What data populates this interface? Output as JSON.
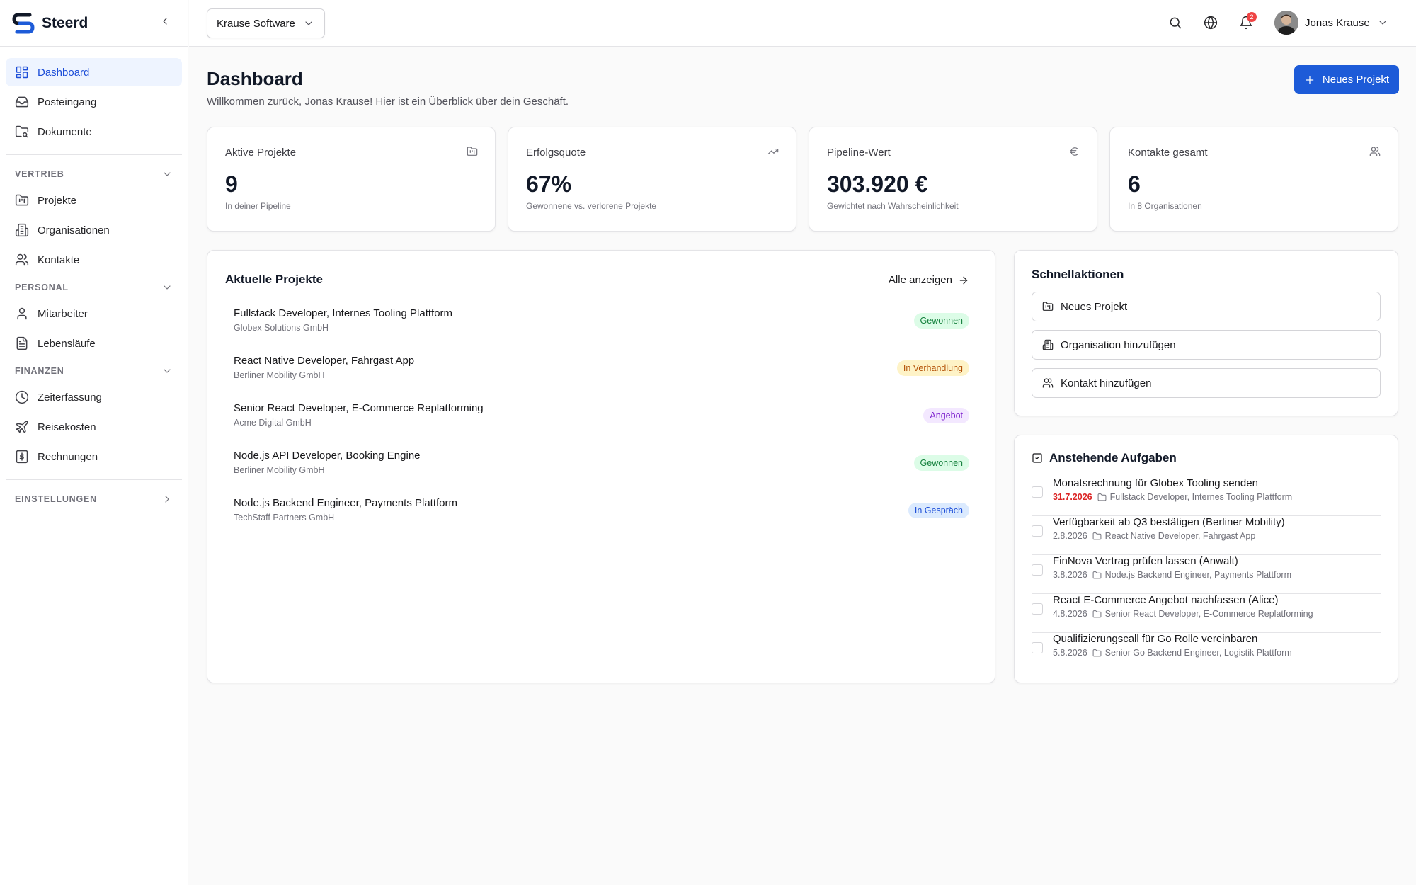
{
  "brand": {
    "name": "Steerd"
  },
  "sidebar": {
    "top_items": [
      {
        "label": "Dashboard",
        "icon": "layout-dashboard-icon",
        "active": true
      },
      {
        "label": "Posteingang",
        "icon": "inbox-icon"
      },
      {
        "label": "Dokumente",
        "icon": "folder-search-icon"
      }
    ],
    "groups": [
      {
        "label": "VERTRIEB",
        "expanded": true,
        "items": [
          {
            "label": "Projekte",
            "icon": "folder-kanban-icon"
          },
          {
            "label": "Organisationen",
            "icon": "building-icon"
          },
          {
            "label": "Kontakte",
            "icon": "users-icon"
          }
        ]
      },
      {
        "label": "PERSONAL",
        "expanded": true,
        "items": [
          {
            "label": "Mitarbeiter",
            "icon": "user-icon"
          },
          {
            "label": "Lebensläufe",
            "icon": "file-text-icon"
          }
        ]
      },
      {
        "label": "FINANZEN",
        "expanded": true,
        "items": [
          {
            "label": "Zeiterfassung",
            "icon": "clock-icon"
          },
          {
            "label": "Reisekosten",
            "icon": "plane-icon"
          },
          {
            "label": "Rechnungen",
            "icon": "receipt-icon"
          }
        ]
      },
      {
        "label": "EINSTELLUNGEN",
        "expanded": false,
        "items": []
      }
    ]
  },
  "topbar": {
    "organization": "Krause Software",
    "notification_count": "2",
    "user_name": "Jonas Krause"
  },
  "page": {
    "title": "Dashboard",
    "subtitle": "Willkommen zurück, Jonas Krause! Hier ist ein Überblick über dein Geschäft.",
    "new_project_label": "Neues Projekt"
  },
  "stats": [
    {
      "label": "Aktive Projekte",
      "value": "9",
      "hint": "In deiner Pipeline",
      "icon": "folder-kanban-icon"
    },
    {
      "label": "Erfolgsquote",
      "value": "67%",
      "hint": "Gewonnene vs. verlorene Projekte",
      "icon": "trending-up-icon"
    },
    {
      "label": "Pipeline-Wert",
      "value": "303.920 €",
      "hint": "Gewichtet nach Wahrscheinlichkeit",
      "icon": "euro-icon"
    },
    {
      "label": "Kontakte gesamt",
      "value": "6",
      "hint": "In 8 Organisationen",
      "icon": "users-icon"
    }
  ],
  "recent_projects": {
    "title": "Aktuelle Projekte",
    "show_all_label": "Alle anzeigen",
    "items": [
      {
        "name": "Fullstack Developer, Internes Tooling Plattform",
        "org": "Globex Solutions GmbH",
        "status": "Gewonnen",
        "status_bg": "#dcfce7",
        "status_color": "#15803d"
      },
      {
        "name": "React Native Developer, Fahrgast App",
        "org": "Berliner Mobility GmbH",
        "status": "In Verhandlung",
        "status_bg": "#fef3c7",
        "status_color": "#b45309"
      },
      {
        "name": "Senior React Developer, E-Commerce Replatforming",
        "org": "Acme Digital GmbH",
        "status": "Angebot",
        "status_bg": "#f3e8ff",
        "status_color": "#7e22ce"
      },
      {
        "name": "Node.js API Developer, Booking Engine",
        "org": "Berliner Mobility GmbH",
        "status": "Gewonnen",
        "status_bg": "#dcfce7",
        "status_color": "#15803d"
      },
      {
        "name": "Node.js Backend Engineer, Payments Plattform",
        "org": "TechStaff Partners GmbH",
        "status": "In Gespräch",
        "status_bg": "#dbeafe",
        "status_color": "#1d4ed8"
      }
    ]
  },
  "quick_actions": {
    "title": "Schnellaktionen",
    "items": [
      {
        "label": "Neues Projekt",
        "icon": "folder-kanban-icon"
      },
      {
        "label": "Organisation hinzufügen",
        "icon": "building-icon"
      },
      {
        "label": "Kontakt hinzufügen",
        "icon": "users-icon"
      }
    ]
  },
  "tasks": {
    "title": "Anstehende Aufgaben",
    "items": [
      {
        "title": "Monatsrechnung für Globex Tooling senden",
        "date": "31.7.2026",
        "overdue": true,
        "project": "Fullstack Developer, Internes Tooling Plattform"
      },
      {
        "title": "Verfügbarkeit ab Q3 bestätigen (Berliner Mobility)",
        "date": "2.8.2026",
        "overdue": false,
        "project": "React Native Developer, Fahrgast App"
      },
      {
        "title": "FinNova Vertrag prüfen lassen (Anwalt)",
        "date": "3.8.2026",
        "overdue": false,
        "project": "Node.js Backend Engineer, Payments Plattform"
      },
      {
        "title": "React E-Commerce Angebot nachfassen (Alice)",
        "date": "4.8.2026",
        "overdue": false,
        "project": "Senior React Developer, E-Commerce Replatforming"
      },
      {
        "title": "Qualifizierungscall für Go Rolle vereinbaren",
        "date": "5.8.2026",
        "overdue": false,
        "project": "Senior Go Backend Engineer, Logistik Plattform"
      }
    ]
  },
  "colors": {
    "accent": "#1d5bd8",
    "active_nav_bg": "#eef4ff",
    "overdue": "#dc2626"
  }
}
